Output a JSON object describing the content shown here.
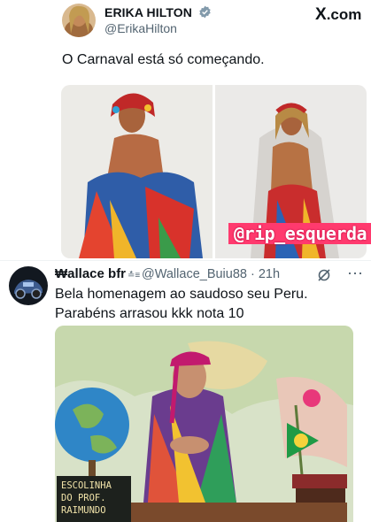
{
  "tweet": {
    "author_name": "ERIKA HILTON",
    "author_handle": "@ErikaHilton",
    "text": "O Carnaval está só começando.",
    "watermark": "@rip_esquerda",
    "brand": "X",
    "brand_suffix": ".com"
  },
  "reply": {
    "author_name": "₩allace bfr",
    "author_badge": "≛≡",
    "author_handle": "@Wallace_Buiu88 · 21h",
    "text_line1": "Bela homenagem ao saudoso seu Peru.",
    "text_line2": "Parabéns arrasou kkk nota 10",
    "sign_text": "ESCOLINHA\nDO PROF.\nRAIMUNDO"
  },
  "colors": {
    "verified": "#829aab",
    "secondary_text": "#536471",
    "watermark_bg": "#ff3a6e"
  }
}
